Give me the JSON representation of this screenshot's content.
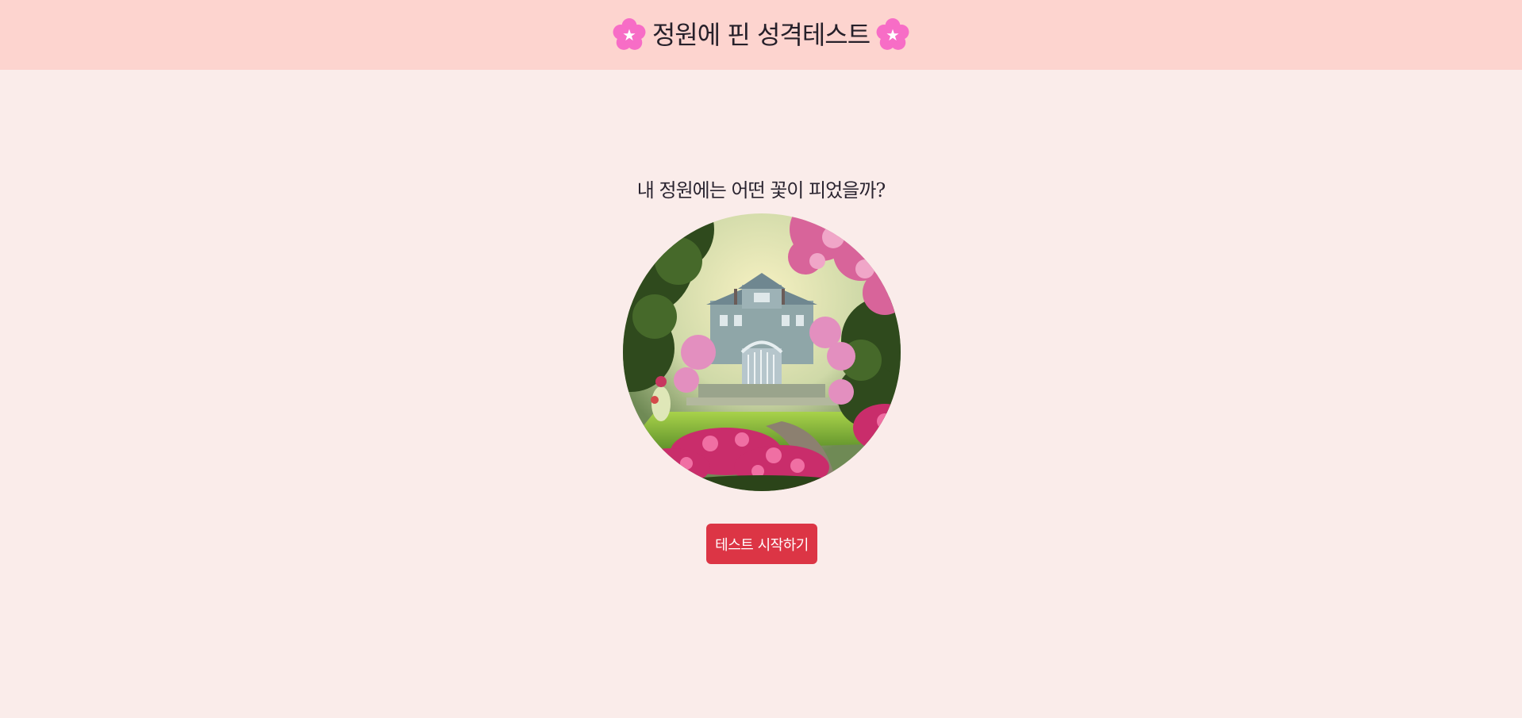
{
  "header": {
    "title": "정원에 핀 성격테스트",
    "left_icon": "cherry-blossom-icon",
    "right_icon": "cherry-blossom-icon",
    "background": "#fdd4cf"
  },
  "main": {
    "subtitle": "내 정원에는 어떤 꽃이 피었을까?",
    "image": "garden-illustration",
    "start_button_label": "테스트 시작하기",
    "background": "#faecea"
  },
  "colors": {
    "accent": "#dc3545",
    "blossom": "#f76dc6"
  }
}
